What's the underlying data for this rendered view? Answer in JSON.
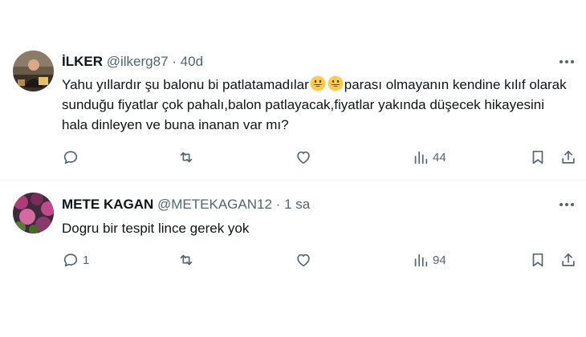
{
  "tweets": [
    {
      "name": "İLKER",
      "handle": "@ilkerg87",
      "separator": "·",
      "time": "40d",
      "text_before": "Yahu yıllardır şu balonu bi patlatamadılar",
      "emojis": [
        "grinning-face",
        "grinning-face"
      ],
      "text_after": "parası olmayanın kendine kılıf olarak sunduğu fiyatlar çok pahalı,balon patlayacak,fiyatlar yakında düşecek hikayesini hala dinleyen ve buna inanan var mı?",
      "replies": "",
      "views": "44"
    },
    {
      "name": "METE KAGAN",
      "handle": "@METEKAGAN12",
      "separator": "·",
      "time": "1 sa",
      "text": "Dogru bir tespit lince gerek yok",
      "replies": "1",
      "views": "94"
    }
  ],
  "icons": {
    "reply": "reply-icon",
    "retweet": "retweet-icon",
    "like": "heart-icon",
    "views": "views-icon",
    "bookmark": "bookmark-icon",
    "share": "share-icon",
    "more": "more-icon"
  },
  "colors": {
    "text": "#0f1419",
    "muted": "#536471",
    "divider": "#eff3f4",
    "emoji": "#ffcc4d"
  }
}
